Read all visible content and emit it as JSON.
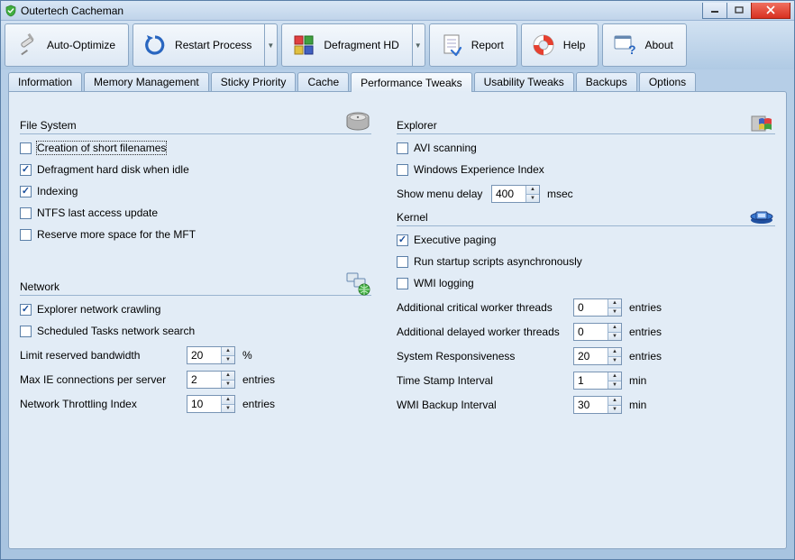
{
  "window": {
    "title": "Outertech Cacheman"
  },
  "toolbar": {
    "auto_optimize": "Auto-Optimize",
    "restart_process": "Restart Process",
    "defragment_hd": "Defragment HD",
    "report": "Report",
    "help": "Help",
    "about": "About"
  },
  "tabs": {
    "information": "Information",
    "memory_management": "Memory Management",
    "sticky_priority": "Sticky Priority",
    "cache": "Cache",
    "performance_tweaks": "Performance Tweaks",
    "usability_tweaks": "Usability Tweaks",
    "backups": "Backups",
    "options": "Options"
  },
  "groups": {
    "file_system": "File System",
    "network": "Network",
    "explorer": "Explorer",
    "kernel": "Kernel"
  },
  "file_system": {
    "short_filenames": {
      "label": "Creation of short filenames",
      "checked": false
    },
    "defragment_idle": {
      "label": "Defragment hard disk when idle",
      "checked": true
    },
    "indexing": {
      "label": "Indexing",
      "checked": true
    },
    "ntfs_last_access": {
      "label": "NTFS last access update",
      "checked": false
    },
    "reserve_mft": {
      "label": "Reserve more space for the MFT",
      "checked": false
    }
  },
  "network": {
    "explorer_crawling": {
      "label": "Explorer network crawling",
      "checked": true
    },
    "scheduled_tasks_search": {
      "label": "Scheduled Tasks network search",
      "checked": false
    },
    "limit_reserved_bw": {
      "label": "Limit reserved bandwidth",
      "value": "20",
      "unit": "%"
    },
    "max_ie_conn": {
      "label": "Max IE connections per server",
      "value": "2",
      "unit": "entries"
    },
    "throttling_index": {
      "label": "Network Throttling Index",
      "value": "10",
      "unit": "entries"
    }
  },
  "explorer": {
    "avi_scanning": {
      "label": "AVI scanning",
      "checked": false
    },
    "wei": {
      "label": "Windows Experience Index",
      "checked": false
    },
    "menu_delay": {
      "label": "Show menu delay",
      "value": "400",
      "unit": "msec"
    }
  },
  "kernel": {
    "exec_paging": {
      "label": "Executive paging",
      "checked": true
    },
    "startup_async": {
      "label": "Run startup scripts asynchronously",
      "checked": false
    },
    "wmi_logging": {
      "label": "WMI logging",
      "checked": false
    },
    "add_critical_workers": {
      "label": "Additional critical worker threads",
      "value": "0",
      "unit": "entries"
    },
    "add_delayed_workers": {
      "label": "Additional delayed worker threads",
      "value": "0",
      "unit": "entries"
    },
    "sys_responsiveness": {
      "label": "System Responsiveness",
      "value": "20",
      "unit": "entries"
    },
    "time_stamp_interval": {
      "label": "Time Stamp Interval",
      "value": "1",
      "unit": "min"
    },
    "wmi_backup_interval": {
      "label": "WMI Backup Interval",
      "value": "30",
      "unit": "min"
    }
  }
}
